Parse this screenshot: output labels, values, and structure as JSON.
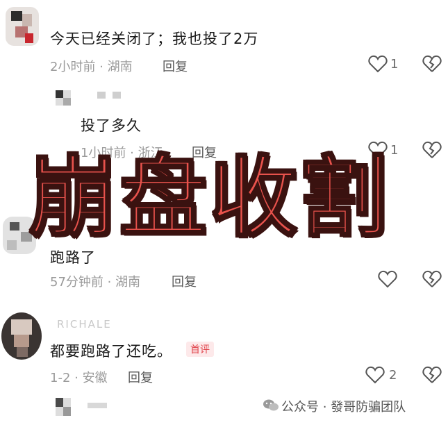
{
  "comments": [
    {
      "text": "今天已经关闭了；我也投了2万",
      "meta": "2小时前 · 湖南",
      "reply": "回复",
      "likes": "1"
    },
    {
      "text": "投了多久",
      "meta": "1小时前 · 浙江",
      "reply": "回复",
      "likes": "1"
    },
    {
      "text": "跑路了",
      "meta": "57分钟前 · 湖南",
      "reply": "回复",
      "likes": ""
    },
    {
      "text": "都要跑路了还吃。",
      "badge": "首评",
      "meta": "1-2 · 安徽",
      "reply": "回复",
      "likes": "2"
    }
  ],
  "overlay_text": "崩盘收割",
  "partial_username": "RICHALE",
  "watermark": "公众号 · 發哥防骗团队",
  "icons": {
    "like": "heart-outline-icon",
    "dislike": "broken-heart-icon",
    "wechat": "wechat-icon"
  },
  "colors": {
    "overlay": "#e8524c",
    "overlay_stroke": "#3a1210",
    "badge": "#e0424a",
    "meta": "#9a9a9a"
  }
}
